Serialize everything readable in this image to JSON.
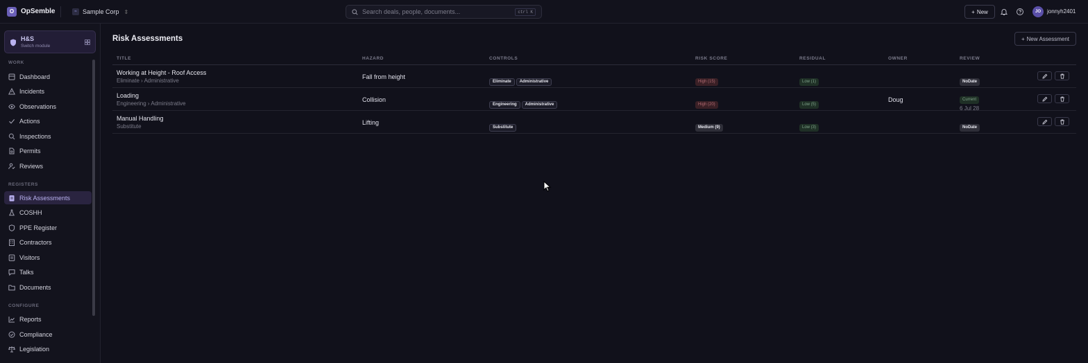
{
  "app": {
    "logo_letter": "O",
    "name": "OpSemble"
  },
  "org": {
    "icon_glyph": "≈",
    "name": "Sample Corp"
  },
  "search": {
    "placeholder": "Search deals, people, documents...",
    "shortcut": "ctrl K"
  },
  "header": {
    "new_label": "New",
    "avatar_initials": "JO",
    "username": "jonnyh2401"
  },
  "module": {
    "name": "H&S",
    "subtitle": "Switch module"
  },
  "sidebar": {
    "sections": [
      {
        "label": "WORK",
        "items": [
          {
            "label": "Dashboard",
            "icon": "dashboard-icon"
          },
          {
            "label": "Incidents",
            "icon": "warning-icon"
          },
          {
            "label": "Observations",
            "icon": "eye-icon"
          },
          {
            "label": "Actions",
            "icon": "check-icon"
          },
          {
            "label": "Inspections",
            "icon": "search-icon"
          },
          {
            "label": "Permits",
            "icon": "permit-icon"
          },
          {
            "label": "Reviews",
            "icon": "user-check-icon"
          }
        ]
      },
      {
        "label": "REGISTERS",
        "items": [
          {
            "label": "Risk Assessments",
            "icon": "clipboard-icon",
            "active": true
          },
          {
            "label": "COSHH",
            "icon": "flask-icon"
          },
          {
            "label": "PPE Register",
            "icon": "shield-icon"
          },
          {
            "label": "Contractors",
            "icon": "building-icon"
          },
          {
            "label": "Visitors",
            "icon": "badge-icon"
          },
          {
            "label": "Talks",
            "icon": "chat-icon"
          },
          {
            "label": "Documents",
            "icon": "folder-icon"
          }
        ]
      },
      {
        "label": "CONFIGURE",
        "items": [
          {
            "label": "Reports",
            "icon": "chart-icon"
          },
          {
            "label": "Compliance",
            "icon": "check-circle-icon"
          },
          {
            "label": "Legislation",
            "icon": "scale-icon"
          }
        ]
      }
    ]
  },
  "page": {
    "title": "Risk Assessments",
    "new_assessment_label": "New Assessment"
  },
  "table": {
    "columns": [
      "TITLE",
      "HAZARD",
      "CONTROLS",
      "RISK SCORE",
      "RESIDUAL",
      "OWNER",
      "REVIEW"
    ],
    "rows": [
      {
        "title": "Working at Height - Roof Access",
        "subtitle": "Eliminate › Administrative",
        "hazard": "Fall from height",
        "controls": [
          "Eliminate",
          "Administrative"
        ],
        "risk": {
          "label": "High (15)",
          "level": "high"
        },
        "residual": {
          "label": "Low (1)",
          "level": "low"
        },
        "owner": "",
        "review": {
          "label": "NoDate",
          "status": "nodate",
          "date": ""
        }
      },
      {
        "title": "Loading",
        "subtitle": "Engineering › Administrative",
        "hazard": "Collision",
        "controls": [
          "Engineering",
          "Administrative"
        ],
        "risk": {
          "label": "High (20)",
          "level": "high"
        },
        "residual": {
          "label": "Low (5)",
          "level": "low"
        },
        "owner": "Doug",
        "review": {
          "label": "Current",
          "status": "current",
          "date": "6 Jul 28"
        }
      },
      {
        "title": "Manual Handling",
        "subtitle": "Substitute",
        "hazard": "Lifting",
        "controls": [
          "Substitute"
        ],
        "risk": {
          "label": "Medium (9)",
          "level": "medium"
        },
        "residual": {
          "label": "Low (3)",
          "level": "low"
        },
        "owner": "",
        "review": {
          "label": "NoDate",
          "status": "nodate",
          "date": ""
        }
      }
    ]
  },
  "colors": {
    "accent": "#6a5fb8",
    "background": "#11111b",
    "high": "#b26a72",
    "low": "#7fa38a"
  }
}
